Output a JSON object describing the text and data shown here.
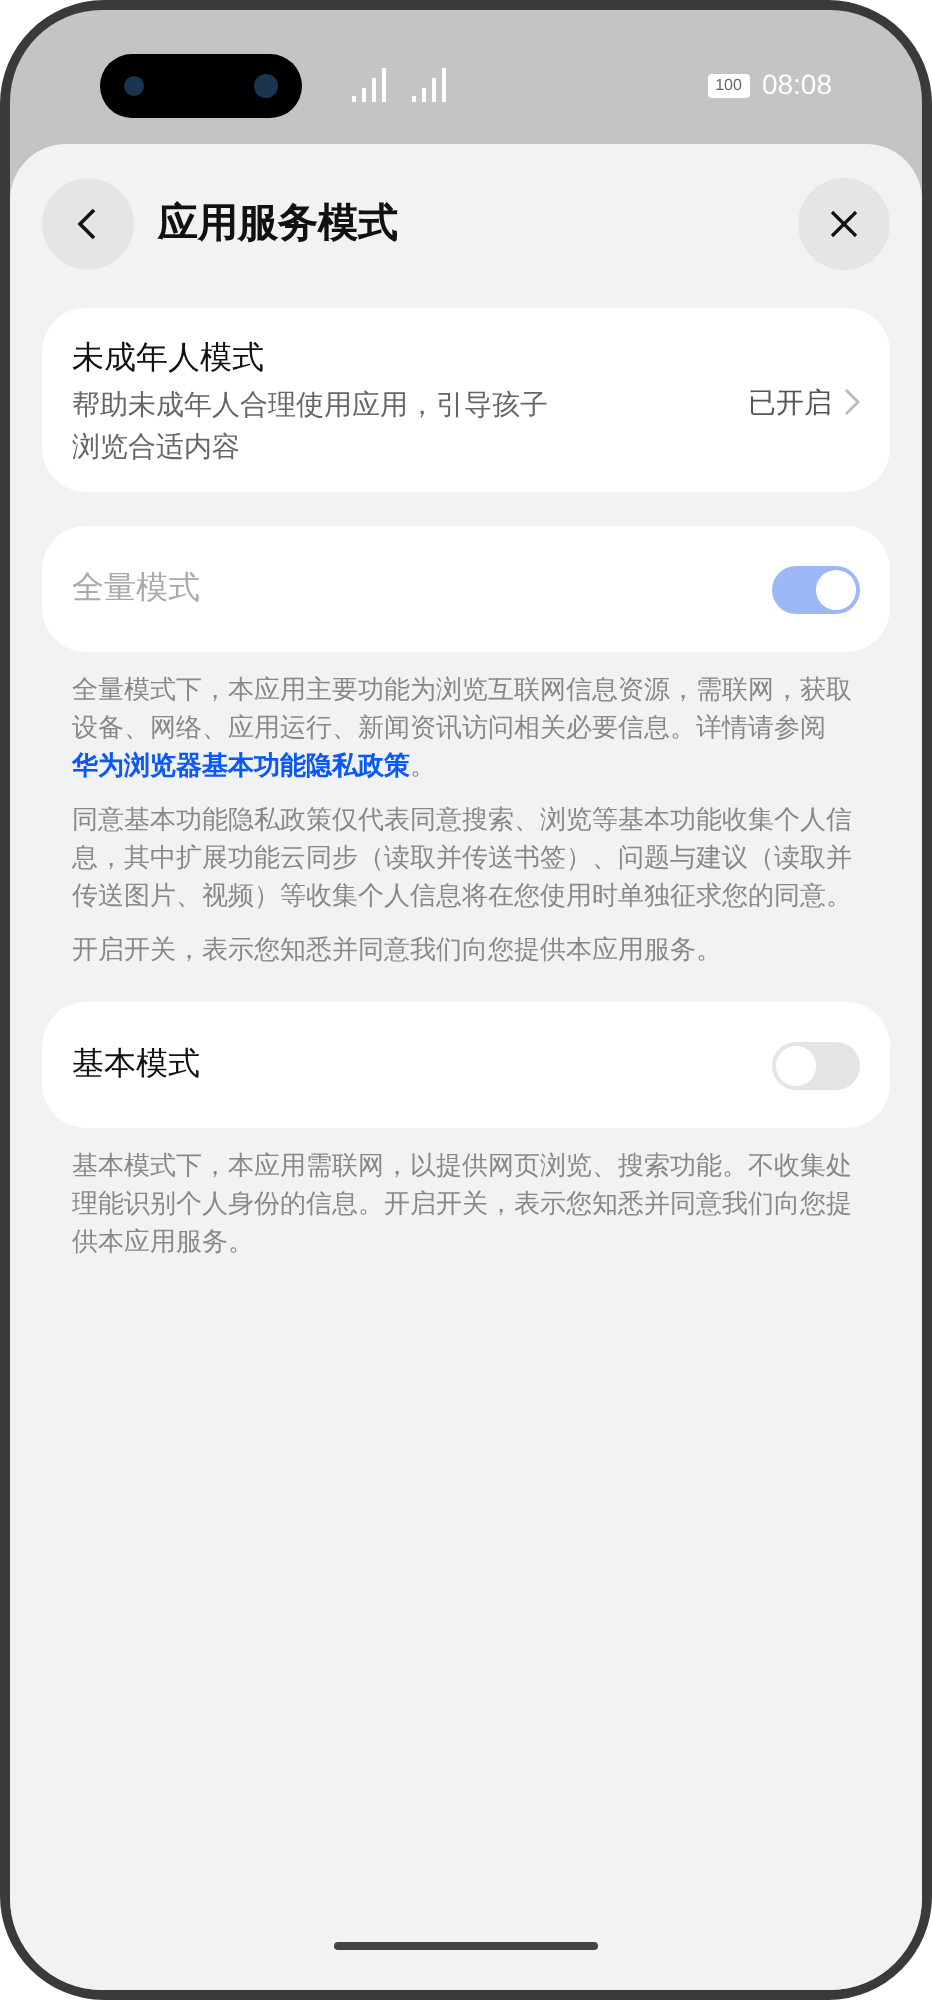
{
  "status_bar": {
    "battery": "100",
    "time": "08:08"
  },
  "header": {
    "title": "应用服务模式"
  },
  "minor_mode": {
    "title": "未成年人模式",
    "description": "帮助未成年人合理使用应用，引导孩子浏览合适内容",
    "status": "已开启"
  },
  "settings": [
    {
      "label": "全量模式",
      "on": true,
      "disabled": true,
      "notes": [
        [
          {
            "kind": "text",
            "text": "全量模式下，本应用主要功能为浏览互联网信息资源，需联网，获取设备、网络、应用运行、新闻资讯访问相关必要信息。详情请参阅"
          },
          {
            "kind": "link",
            "text": "华为浏览器基本功能隐私政策"
          },
          {
            "kind": "text",
            "text": "。"
          }
        ],
        [
          {
            "kind": "text",
            "text": "同意基本功能隐私政策仅代表同意搜索、浏览等基本功能收集个人信息，其中扩展功能云同步（读取并传送书签）、问题与建议（读取并传送图片、视频）等收集个人信息将在您使用时单独征求您的同意。"
          }
        ],
        [
          {
            "kind": "text",
            "text": "开启开关，表示您知悉并同意我们向您提供本应用服务。"
          }
        ]
      ]
    },
    {
      "label": "基本模式",
      "on": false,
      "disabled": false,
      "notes": [
        [
          {
            "kind": "text",
            "text": "基本模式下，本应用需联网，以提供网页浏览、搜索功能。不收集处理能识别个人身份的信息。开启开关，表示您知悉并同意我们向您提供本应用服务。"
          }
        ]
      ]
    }
  ]
}
